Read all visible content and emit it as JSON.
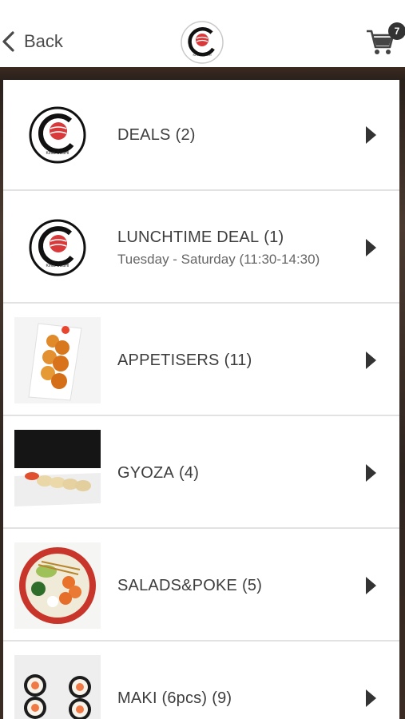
{
  "header": {
    "back_label": "Back",
    "logo_text": "KING SUSHI",
    "cart_count": "7",
    "colors": {
      "text": "#4a4a4a",
      "badge": "#333333"
    }
  },
  "categories": [
    {
      "title": "DEALS",
      "count": "(2)",
      "subtitle": "",
      "thumb": "logo"
    },
    {
      "title": "LUNCHTIME DEAL",
      "count": "(1)",
      "subtitle": "Tuesday - Saturday (11:30-14:30)",
      "thumb": "logo"
    },
    {
      "title": "APPETISERS",
      "count": "(11)",
      "subtitle": "",
      "thumb": "appetisers-photo"
    },
    {
      "title": "GYOZA",
      "count": "(4)",
      "subtitle": "",
      "thumb": "gyoza-photo"
    },
    {
      "title": "SALADS&POKE",
      "count": "(5)",
      "subtitle": "",
      "thumb": "poke-photo"
    },
    {
      "title": "MAKI (6pcs)",
      "count": "(9)",
      "subtitle": "",
      "thumb": "maki-photo"
    }
  ],
  "icons": {
    "back": "chevron-left-icon",
    "cart": "shopping-cart-icon",
    "arrow": "caret-right-icon"
  }
}
